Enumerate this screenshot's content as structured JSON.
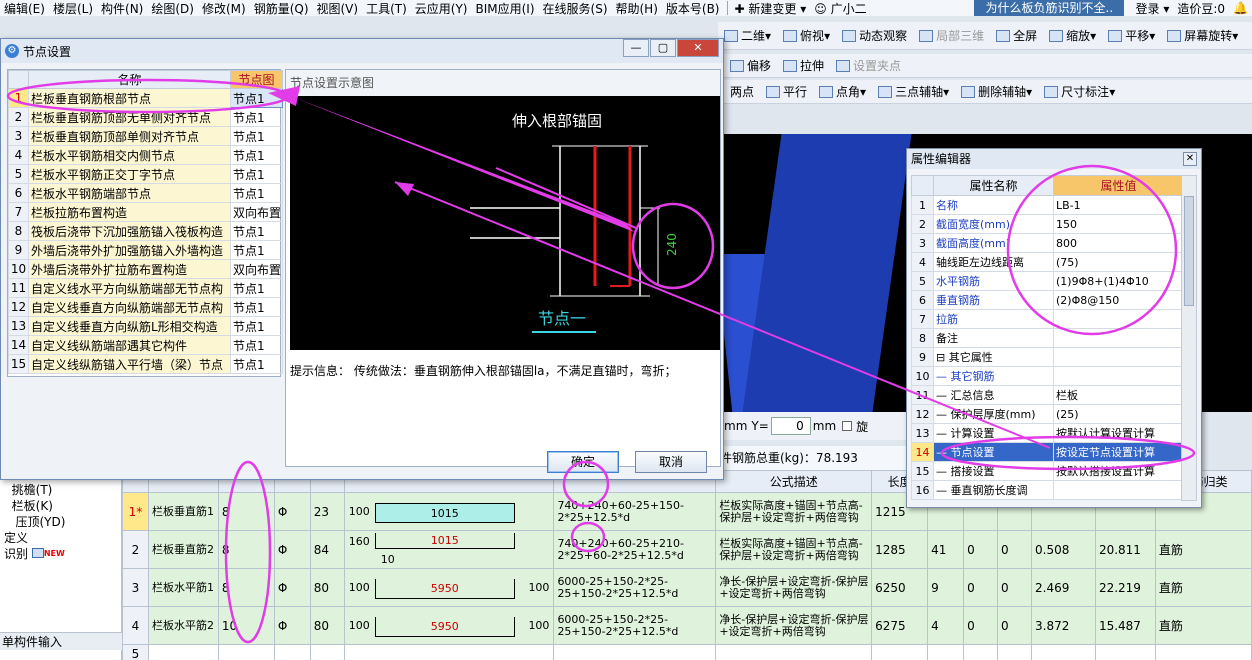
{
  "menu": {
    "items": [
      "编辑(E)",
      "楼层(L)",
      "构件(N)",
      "绘图(D)",
      "修改(M)",
      "钢筋量(Q)",
      "视图(V)",
      "工具(T)",
      "云应用(Y)",
      "BIM应用(I)",
      "在线服务(S)",
      "帮助(H)",
      "版本号(B)"
    ],
    "new_change": "新建变更",
    "assistant": "广小二",
    "question": "为什么板负筋识别不全..",
    "login": "登录",
    "bean": "造价豆:0"
  },
  "toolbar": {
    "row1": [
      "二维",
      "俯视",
      "动态观察",
      "局部三维",
      "全屏",
      "缩放",
      "平移",
      "屏幕旋转"
    ],
    "row2": [
      "偏移",
      "拉伸",
      "设置夹点"
    ],
    "row3": [
      "两点",
      "平行",
      "点角",
      "三点辅轴",
      "删除辅轴",
      "尺寸标注"
    ]
  },
  "coords": {
    "unit": "mm",
    "y_label": "Y=",
    "y_value": "0",
    "rotate_label": "旋"
  },
  "total": {
    "text": "件钢筋总重(kg)：78.193"
  },
  "dialog": {
    "title": "节点设置",
    "col_name": "名称",
    "col_node": "节点图",
    "rows": [
      {
        "n": "1",
        "name": "栏板垂直钢筋根部节点",
        "val": "节点1"
      },
      {
        "n": "2",
        "name": "栏板垂直钢筋顶部无单侧对齐节点",
        "val": "节点1"
      },
      {
        "n": "3",
        "name": "栏板垂直钢筋顶部单侧对齐节点",
        "val": "节点1"
      },
      {
        "n": "4",
        "name": "栏板水平钢筋相交内侧节点",
        "val": "节点1"
      },
      {
        "n": "5",
        "name": "栏板水平钢筋正交丁字节点",
        "val": "节点1"
      },
      {
        "n": "6",
        "name": "栏板水平钢筋端部节点",
        "val": "节点1"
      },
      {
        "n": "7",
        "name": "栏板拉筋布置构造",
        "val": "双向布置"
      },
      {
        "n": "8",
        "name": "筏板后浇带下沉加强筋锚入筏板构造",
        "val": "节点1"
      },
      {
        "n": "9",
        "name": "外墙后浇带外扩加强筋锚入外墙构造",
        "val": "节点1"
      },
      {
        "n": "10",
        "name": "外墙后浇带外扩拉筋布置构造",
        "val": "双向布置"
      },
      {
        "n": "11",
        "name": "自定义线水平方向纵筋端部无节点构",
        "val": "节点1"
      },
      {
        "n": "12",
        "name": "自定义线垂直方向纵筋端部无节点构",
        "val": "节点1"
      },
      {
        "n": "13",
        "name": "自定义线垂直方向纵筋L形相交构造",
        "val": "节点1"
      },
      {
        "n": "14",
        "name": "自定义线纵筋端部遇其它构件",
        "val": "节点1"
      },
      {
        "n": "15",
        "name": "自定义线纵筋锚入平行墙（梁）节点",
        "val": "节点1"
      }
    ],
    "preview_title": "节点设置示意图",
    "diagram_title": "伸入根部锚固",
    "diagram_dim": "240",
    "diagram_caption": "节点一",
    "hint": "提示信息：  传统做法：垂直钢筋伸入根部锚固la，不满足直锚时，弯折；",
    "ok": "确定",
    "cancel": "取消"
  },
  "properties": {
    "title": "属性编辑器",
    "col_name": "属性名称",
    "col_value": "属性值",
    "rows": [
      {
        "n": "1",
        "name": "名称",
        "value": "LB-1",
        "blue": true
      },
      {
        "n": "2",
        "name": "截面宽度(mm)",
        "value": "150",
        "blue": true
      },
      {
        "n": "3",
        "name": "截面高度(mm)",
        "value": "800",
        "blue": true
      },
      {
        "n": "4",
        "name": "轴线距左边线距离",
        "value": "(75)",
        "blue": false
      },
      {
        "n": "5",
        "name": "水平钢筋",
        "value": "(1)9Φ8+(1)4Φ10",
        "blue": true
      },
      {
        "n": "6",
        "name": "垂直钢筋",
        "value": "(2)Φ8@150",
        "blue": true
      },
      {
        "n": "7",
        "name": "拉筋",
        "value": "",
        "blue": true
      },
      {
        "n": "8",
        "name": "备注",
        "value": "",
        "blue": false
      },
      {
        "n": "9",
        "name": "⊟ 其它属性",
        "value": "",
        "blue": false
      },
      {
        "n": "10",
        "name": "— 其它钢筋",
        "value": "",
        "blue": true
      },
      {
        "n": "11",
        "name": "— 汇总信息",
        "value": "栏板",
        "blue": false
      },
      {
        "n": "12",
        "name": "— 保护层厚度(mm)",
        "value": "(25)",
        "blue": false
      },
      {
        "n": "13",
        "name": "— 计算设置",
        "value": "按默认计算设置计算",
        "blue": false
      },
      {
        "n": "14",
        "name": "— 节点设置",
        "value": "按设定节点设置计算",
        "blue": false
      },
      {
        "n": "15",
        "name": "— 搭接设置",
        "value": "按默认搭接设置计算",
        "blue": false
      },
      {
        "n": "16",
        "name": "— 垂直钢筋长度调",
        "value": "",
        "blue": false
      }
    ]
  },
  "left_panel": {
    "items": [
      "挑檐(T)",
      "栏板(K)",
      "压顶(YD)",
      "定义",
      "识别"
    ],
    "new_tag": "NEW",
    "bottom": "单构件输入"
  },
  "grid": {
    "headers": {
      "formula_desc": "公式描述",
      "length": "长度",
      "last": "钢筋归类"
    },
    "rows": [
      {
        "n": "1*",
        "name": "栏板垂直筋1",
        "dia": "8",
        "grade": "Φ",
        "code": "23",
        "lead": "100",
        "bar": "1015",
        "tail": "",
        "formula": "740+240+60-25+150-2*25+12.5*d",
        "desc": "栏板实际高度+锚固+节点高-保护层+设定弯折+两倍弯钩",
        "length": "1215",
        "count": "",
        "c1": "",
        "c2": "",
        "w1": "",
        "w2": "",
        "cat": ""
      },
      {
        "n": "2",
        "name": "栏板垂直筋2",
        "dia": "8",
        "grade": "Φ",
        "code": "84",
        "lead": "160",
        "bar": "1015",
        "tail": "10",
        "formula": "740+240+60-25+210-2*25+60-2*25+12.5*d",
        "desc": "栏板实际高度+锚固+节点高-保护层+设定弯折+两倍弯钩",
        "length": "1285",
        "count": "41",
        "c1": "0",
        "c2": "0",
        "w1": "0.508",
        "w2": "20.811",
        "cat": "直筋"
      },
      {
        "n": "3",
        "name": "栏板水平筋1",
        "dia": "8",
        "grade": "Φ",
        "code": "80",
        "lead": "100",
        "bar": "5950",
        "tail": "100",
        "formula": "6000-25+150-2*25-25+150-2*25+12.5*d",
        "desc": "净长-保护层+设定弯折-保护层+设定弯折+两倍弯钩",
        "length": "6250",
        "count": "9",
        "c1": "0",
        "c2": "0",
        "w1": "2.469",
        "w2": "22.219",
        "cat": "直筋"
      },
      {
        "n": "4",
        "name": "栏板水平筋2",
        "dia": "10",
        "grade": "Φ",
        "code": "80",
        "lead": "100",
        "bar": "5950",
        "tail": "100",
        "formula": "6000-25+150-2*25-25+150-2*25+12.5*d",
        "desc": "净长-保护层+设定弯折-保护层+设定弯折+两倍弯钩",
        "length": "6275",
        "count": "4",
        "c1": "0",
        "c2": "0",
        "w1": "3.872",
        "w2": "15.487",
        "cat": "直筋"
      }
    ],
    "empty_row": "5"
  },
  "colors": {
    "annotation": "#e23ce8",
    "selected": "#ffe88a",
    "row_green": "#dff3dc",
    "header_orange": "#f7c66b"
  }
}
